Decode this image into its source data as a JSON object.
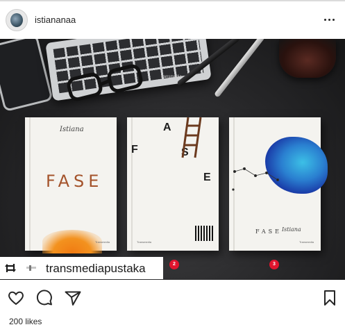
{
  "post": {
    "username": "istiananaa",
    "more_icon": "more-horizontal-icon",
    "likes": "200 likes"
  },
  "image": {
    "repost_tag": "transmediapustaka",
    "watermark": "transmedia",
    "books": [
      {
        "signature": "Istiana",
        "title": "FASE",
        "publisher": "Transmedia"
      },
      {
        "letters": [
          "A",
          "F",
          "S",
          "E"
        ],
        "publisher": "Transmedia"
      },
      {
        "title": "FASE",
        "signature": "Istiana",
        "publisher": "Transmedia"
      }
    ],
    "carousel_markers": [
      "2",
      "3"
    ],
    "marker_color": "#e0152e"
  },
  "actions": {
    "like_icon": "heart-icon",
    "comment_icon": "comment-icon",
    "share_icon": "share-icon",
    "save_icon": "bookmark-icon"
  },
  "colors": {
    "text": "#262626",
    "divider": "#dbdbdb"
  }
}
